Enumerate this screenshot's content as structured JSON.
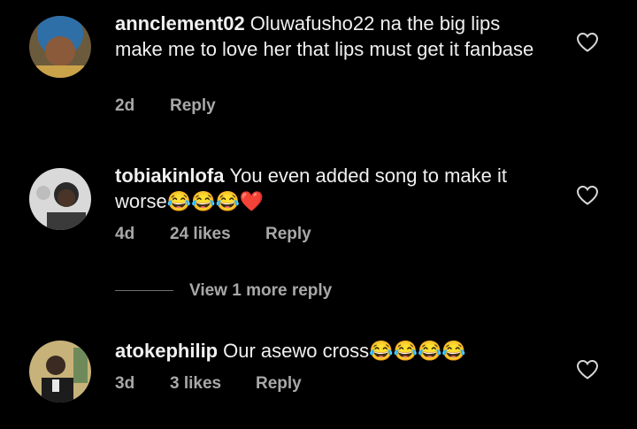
{
  "comments": [
    {
      "username": "annclement02",
      "text": "Oluwafusho22 na the big lips make me to love her that lips must get it fanbase",
      "age": "2d",
      "likes": "",
      "reply_label": "Reply"
    },
    {
      "username": "tobiakinlofa",
      "text": "You even added song to make it worse😂😂😂❤️",
      "age": "4d",
      "likes": "24 likes",
      "reply_label": "Reply"
    },
    {
      "username": "atokephilip",
      "text": "Our asewo cross😂😂😂😂",
      "age": "3d",
      "likes": "3 likes",
      "reply_label": "Reply"
    }
  ],
  "view_more_label": "View 1 more reply",
  "colors": {
    "background": "#000000",
    "text": "#f0f0f0",
    "muted": "#a8a8a8"
  },
  "icons": {
    "like": "heart-outline-icon"
  }
}
